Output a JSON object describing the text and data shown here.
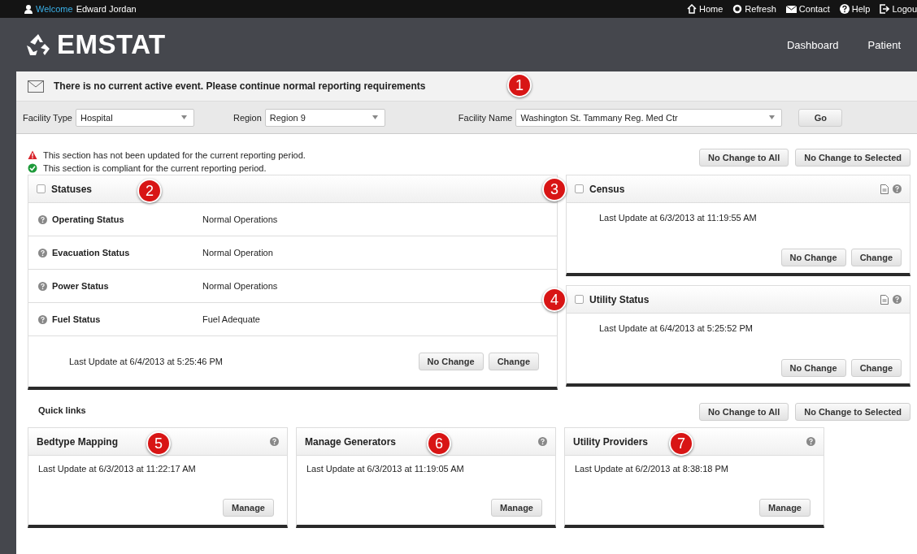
{
  "top_bar": {
    "welcome": "Welcome",
    "user_name": "Edward Jordan",
    "links": [
      {
        "label": "Home"
      },
      {
        "label": "Refresh"
      },
      {
        "label": "Contact"
      },
      {
        "label": "Help"
      },
      {
        "label": "Logou"
      }
    ]
  },
  "header": {
    "logo": "EMSTAT",
    "nav": [
      {
        "label": "Dashboard"
      },
      {
        "label": "Patient"
      }
    ]
  },
  "alert": {
    "message": "There is no current active event. Please continue normal reporting requirements",
    "callout": "1"
  },
  "filters": [
    {
      "label": "Facility Type",
      "value": "Hospital"
    },
    {
      "label": "Region",
      "value": "Region 9"
    },
    {
      "label": "Facility Name",
      "value": "Washington St. Tammany Reg. Med Ctr"
    }
  ],
  "go_button": "Go",
  "legend": [
    {
      "kind": "warning",
      "text": "This section has not been updated for the current reporting period."
    },
    {
      "kind": "ok",
      "text": "This section is compliant for the current reporting period."
    }
  ],
  "bulk_actions": [
    "No Change to All",
    "No Change to Selected"
  ],
  "statuses": {
    "title": "Statuses",
    "checked": false,
    "callout": "2",
    "rows": [
      {
        "label": "Operating Status",
        "value": "Normal Operations"
      },
      {
        "label": "Evacuation Status",
        "value": "Normal Operation"
      },
      {
        "label": "Power Status",
        "value": "Normal Operations"
      },
      {
        "label": "Fuel Status",
        "value": "Fuel Adequate"
      }
    ],
    "last_update": "Last Update at 6/4/2013 at 5:25:46 PM",
    "buttons": [
      "No Change",
      "Change"
    ]
  },
  "side_panels": [
    {
      "title": "Census",
      "checked": false,
      "callout": "3",
      "last_update": "Last Update at 6/3/2013 at 11:19:55 AM",
      "buttons": [
        "No Change",
        "Change"
      ]
    },
    {
      "title": "Utility Status",
      "checked": false,
      "callout": "4",
      "last_update": "Last Update at 6/4/2013 at 5:25:52 PM",
      "buttons": [
        "No Change",
        "Change"
      ]
    }
  ],
  "quick_links": {
    "title": "Quick links",
    "bulk_actions": [
      "No Change to All",
      "No Change to Selected"
    ],
    "cards": [
      {
        "title": "Bedtype Mapping",
        "callout": "5",
        "last_update": "Last Update at 6/3/2013 at 11:22:17 AM",
        "button": "Manage"
      },
      {
        "title": "Manage Generators",
        "callout": "6",
        "last_update": "Last Update at 6/3/2013 at 11:19:05 AM",
        "button": "Manage"
      },
      {
        "title": "Utility Providers",
        "callout": "7",
        "last_update": "Last Update at 6/2/2013 at 8:38:18 PM",
        "button": "Manage"
      }
    ]
  }
}
